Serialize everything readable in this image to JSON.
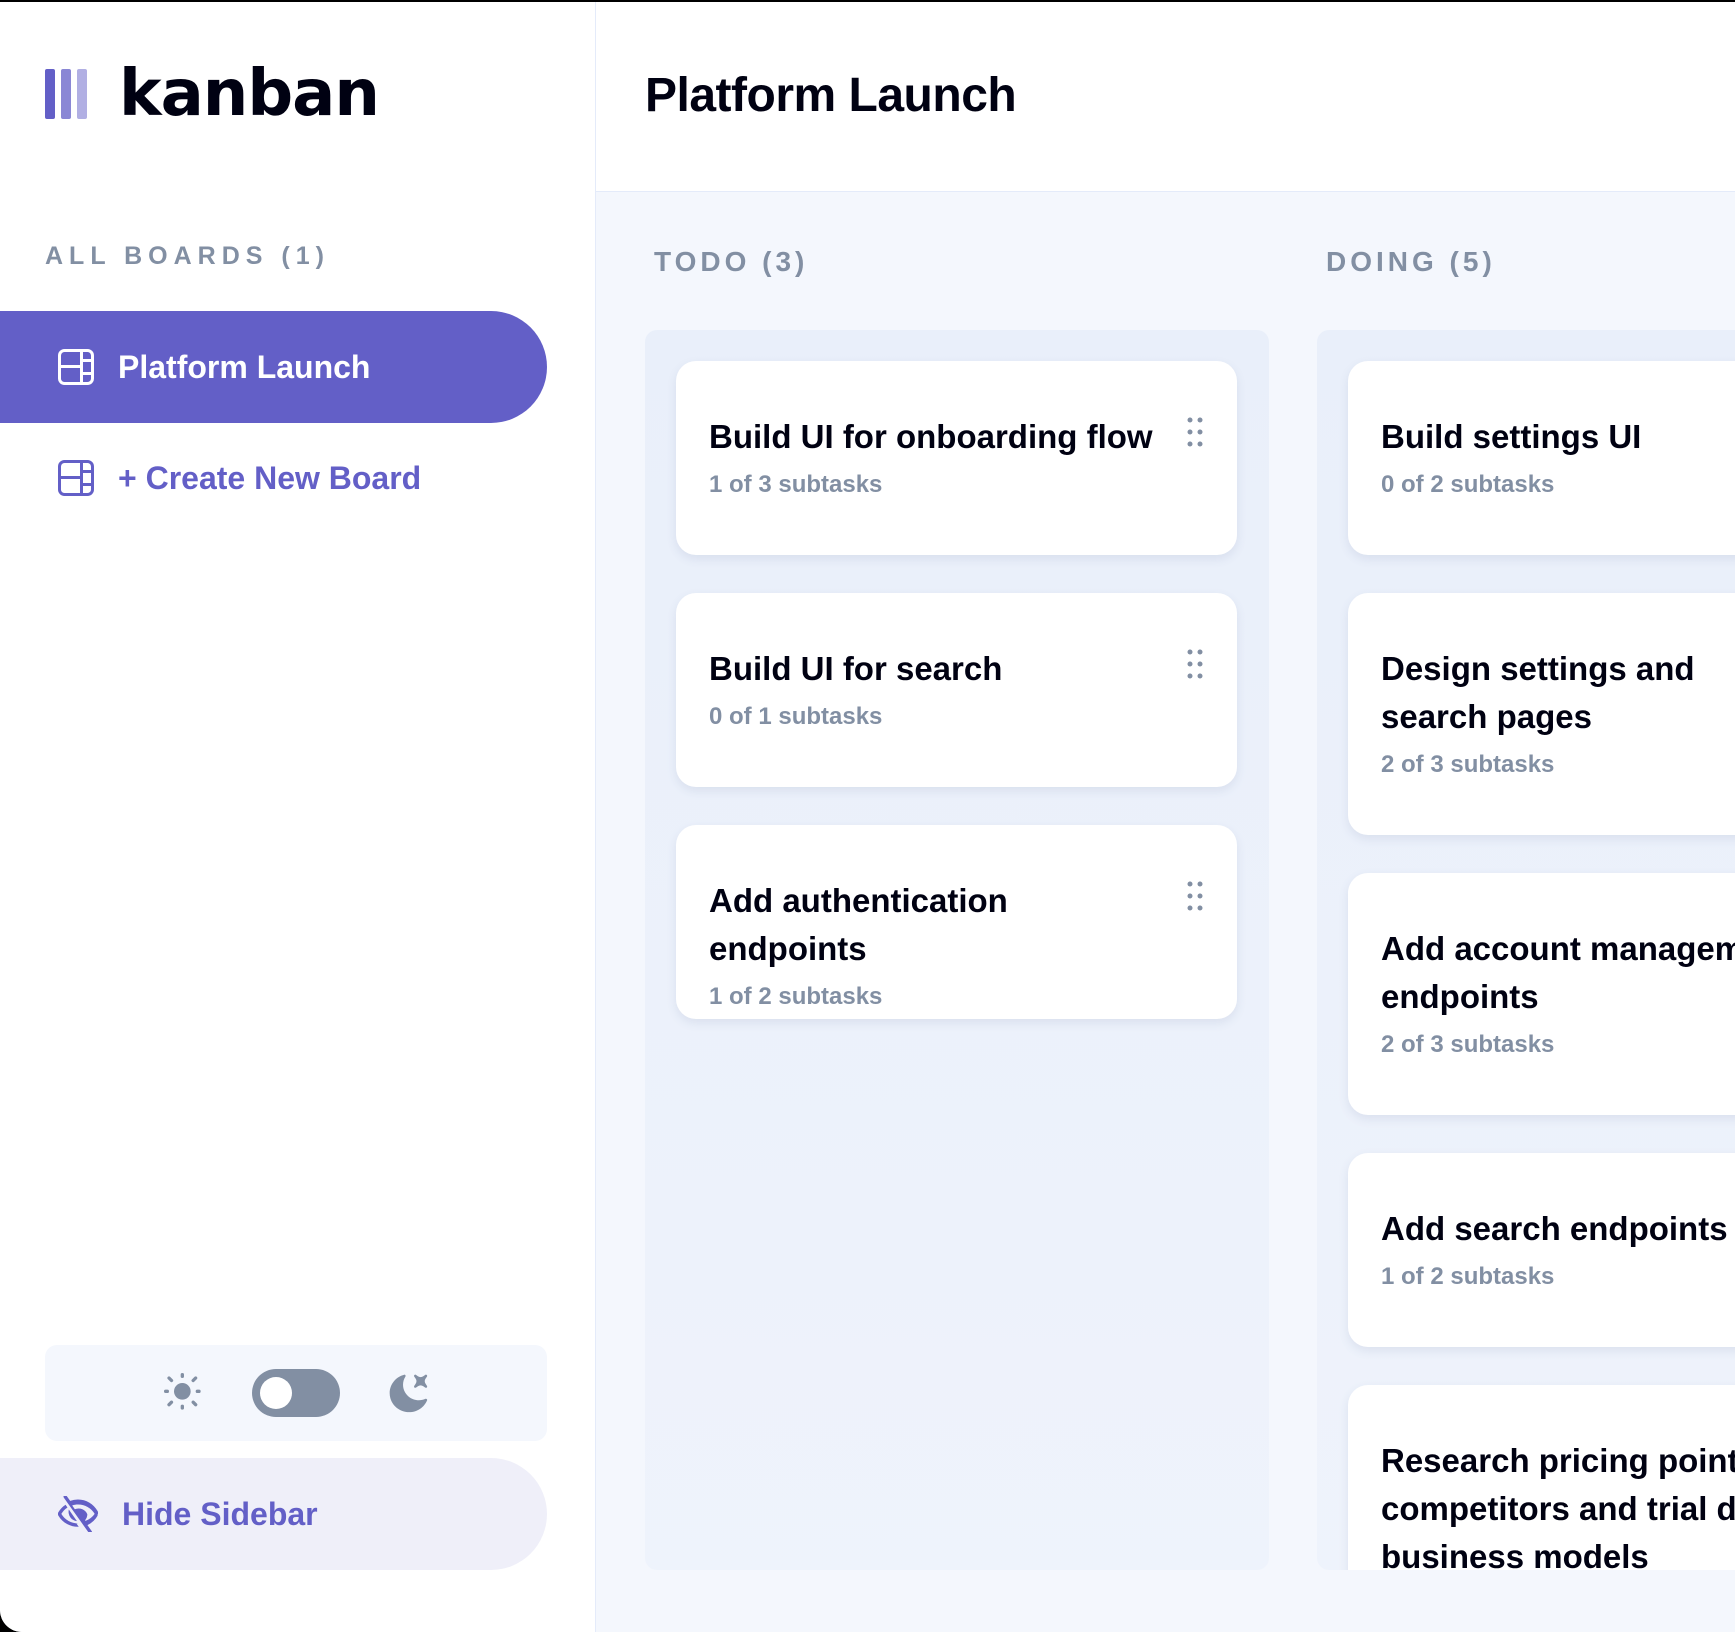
{
  "app": {
    "logo_text": "kanban"
  },
  "colors": {
    "accent": "#635FC7",
    "muted": "#828FA3",
    "board_bg": "#F4F7FD",
    "text": "#000112"
  },
  "sidebar": {
    "heading": "ALL BOARDS (1)",
    "boards": [
      {
        "label": "Platform Launch",
        "icon": "board-icon",
        "active": true
      }
    ],
    "create_label": "+ Create New Board",
    "theme": {
      "light_icon": "sun-icon",
      "dark_icon": "moon-icon",
      "dark_mode": false
    },
    "hide_label": "Hide Sidebar"
  },
  "header": {
    "title": "Platform Launch"
  },
  "columns": [
    {
      "name": "TODO (3)",
      "tasks": [
        {
          "title": "Build UI for onboarding flow",
          "subtasks": "1 of 3 subtasks"
        },
        {
          "title": "Build UI for search",
          "subtasks": "0 of 1 subtasks"
        },
        {
          "title": "Add authentication endpoints",
          "subtasks": "1 of 2 subtasks"
        }
      ]
    },
    {
      "name": "DOING (5)",
      "tasks": [
        {
          "title": "Build settings UI",
          "subtasks": "0 of 2 subtasks"
        },
        {
          "title": "Design settings and search pages",
          "subtasks": "2 of 3 subtasks"
        },
        {
          "title": "Add account management endpoints",
          "subtasks": "2 of 3 subtasks"
        },
        {
          "title": "Add search endpoints",
          "subtasks": "1 of 2 subtasks"
        },
        {
          "title": "Research pricing points of various competitors and trial different business models",
          "subtasks": ""
        }
      ]
    }
  ]
}
